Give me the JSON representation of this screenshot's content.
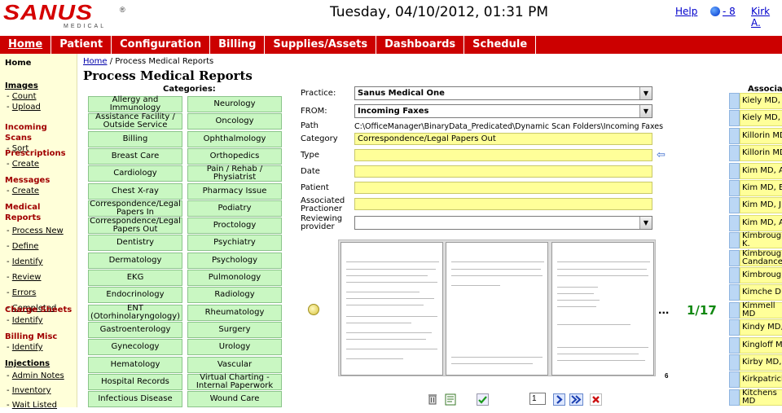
{
  "header": {
    "logo_text": "SANUS",
    "logo_sub": "MEDICAL",
    "logo_reg": "®",
    "datetime": "Tuesday, 04/10/2012, 01:31 PM",
    "help": "Help",
    "notif_count": "- 8",
    "user": "Kirk A."
  },
  "nav": [
    "Home",
    "Patient",
    "Configuration",
    "Billing",
    "Supplies/Assets",
    "Dashboards",
    "Schedule"
  ],
  "sidebar": {
    "home": "Home",
    "groups": [
      {
        "title": "Images",
        "style": "black",
        "links": [
          "Count",
          "Upload"
        ]
      },
      {
        "title": "Incoming Scans",
        "style": "red",
        "links": [
          "Sort"
        ]
      },
      {
        "title": "Prescriptions",
        "style": "red",
        "links": [
          "Create"
        ]
      },
      {
        "title": "Messages",
        "style": "red",
        "links": [
          "Create"
        ]
      },
      {
        "title": "Medical Reports",
        "style": "red",
        "links": [
          "Process New",
          "Define",
          "Identify",
          "Review",
          "Errors",
          "Completed"
        ]
      },
      {
        "title": "Charge Sheets",
        "style": "red",
        "links": [
          "Identify"
        ]
      },
      {
        "title": "Billing Misc",
        "style": "red",
        "links": [
          "Identify"
        ]
      },
      {
        "title": "Injections",
        "style": "black",
        "links": [
          "Admin Notes",
          "Inventory",
          "Wait Listed"
        ]
      }
    ]
  },
  "breadcrumb": {
    "home": "Home",
    "sep": " / ",
    "current": "Process Medical Reports"
  },
  "page_title": "Process Medical Reports",
  "categories_header": "Categories:",
  "categories_left": [
    "Allergy and Immunology",
    "Assistance Facility / Outside Service",
    "Billing",
    "Breast Care",
    "Cardiology",
    "Chest X-ray",
    "Correspondence/Legal Papers In",
    "Correspondence/Legal Papers Out",
    "Dentistry",
    "Dermatology",
    "EKG",
    "Endocrinology",
    "ENT (Otorhinolaryngology)",
    "Gastroenterology",
    "Gynecology",
    "Hematology",
    "Hospital Records",
    "Infectious Disease"
  ],
  "categories_right": [
    "Neurology",
    "Oncology",
    "Ophthalmology",
    "Orthopedics",
    "Pain / Rehab / Physiatrist",
    "Pharmacy Issue",
    "Podiatry",
    "Proctology",
    "Psychiatry",
    "Psychology",
    "Pulmonology",
    "Radiology",
    "Rheumatology",
    "Surgery",
    "Urology",
    "Vascular",
    "Virtual Charting - Internal Paperwork",
    "Wound Care"
  ],
  "form": {
    "practice_label": "Practice:",
    "practice_value": "Sanus Medical One",
    "from_label": "FROM:",
    "from_value": "Incoming Faxes",
    "path_label": "Path",
    "path_value": "C:\\OfficeManager\\BinaryData_Predicated\\Dynamic Scan Folders\\Incoming Faxes",
    "category_label": "Category",
    "category_value": "Correspondence/Legal Papers Out",
    "type_label": "Type",
    "date_label": "Date",
    "patient_label": "Patient",
    "assoc_label": "Associated Practioner",
    "reviewing_label": "Reviewing provider"
  },
  "preview": {
    "page_indicator": "1/17",
    "ellipsis": "...",
    "page_number": "6",
    "page_input": "1"
  },
  "associates": {
    "header": "Associates",
    "items": [
      "Kiely MD, J",
      "Kiely MD, J",
      "Killorin MD",
      "Killorin MD",
      "Kim MD, A",
      "Kim MD, E",
      "Kim MD, J",
      "Kim MD, A",
      "Kimbrough K.",
      "Kimbrough Candance",
      "Kimbrough",
      "Kimche DD",
      "Kimmell MD",
      "Kindy MD, J",
      "Kingloff MD",
      "Kirby MD, J",
      "Kirkpatrick",
      "Kitchens MD"
    ]
  }
}
